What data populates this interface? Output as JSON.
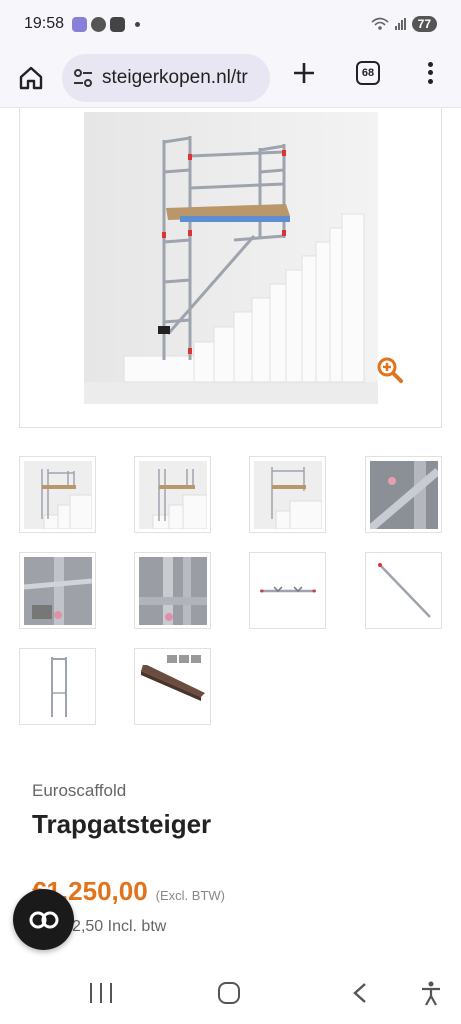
{
  "status_bar": {
    "time": "19:58",
    "battery": "77"
  },
  "browser": {
    "url": "steigerkopen.nl/tr",
    "tab_count": "68",
    "icons": [
      "home-icon",
      "tune-icon",
      "plus-icon",
      "tabs-icon",
      "more-vert-icon"
    ]
  },
  "gallery": {
    "main_image": "stairwell-scaffold-photo",
    "thumbnails": [
      "scaffold-on-stairs-front",
      "scaffold-on-stairs-angle",
      "scaffold-on-stairs-side",
      "brace-connector-closeup",
      "scaffold-frame-detail",
      "scaffold-base-detail",
      "horizontal-brace",
      "diagonal-brace",
      "frame-ladder",
      "platform-deck"
    ]
  },
  "product": {
    "brand": "Euroscaffold",
    "title": "Trapgatsteiger",
    "price": "€1.250,00",
    "price_note": "(Excl. BTW)",
    "price_incl": "€1.512,50 Incl. btw"
  },
  "colors": {
    "accent": "#e0731b",
    "chat_button": "#1a1a1a"
  }
}
